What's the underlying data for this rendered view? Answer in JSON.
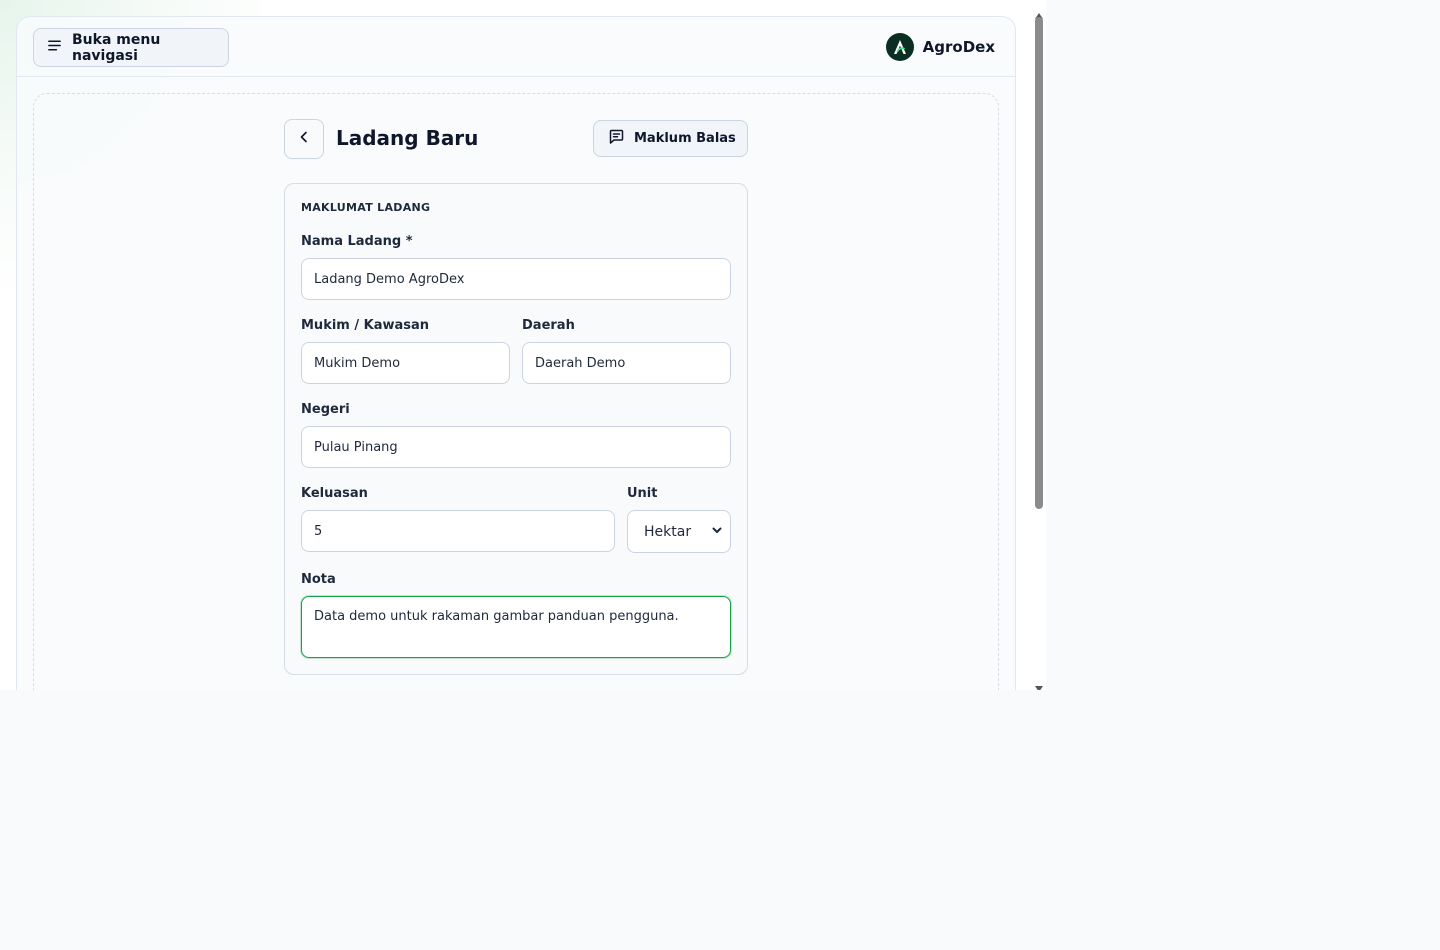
{
  "topbar": {
    "nav_button_label": "Buka menu navigasi",
    "brand_name": "AgroDex"
  },
  "header": {
    "title": "Ladang Baru",
    "feedback_label": "Maklum Balas"
  },
  "form": {
    "section_title": "MAKLUMAT LADANG",
    "farm_name": {
      "label": "Nama Ladang *",
      "value": "Ladang Demo AgroDex"
    },
    "mukim": {
      "label": "Mukim / Kawasan",
      "value": "Mukim Demo"
    },
    "district": {
      "label": "Daerah",
      "value": "Daerah Demo"
    },
    "state": {
      "label": "Negeri",
      "value": "Pulau Pinang"
    },
    "area": {
      "label": "Keluasan",
      "value": "5"
    },
    "unit": {
      "label": "Unit",
      "value": "Hektar"
    },
    "notes": {
      "label": "Nota",
      "value": "Data demo untuk rakaman gambar panduan pengguna."
    }
  },
  "colors": {
    "accent": "#16a34a",
    "brand_logo_bg": "#0b2e22",
    "border": "#cbd5e1",
    "text": "#0f172a"
  },
  "icons": {
    "nav": "menu-icon",
    "back": "chevron-left-icon",
    "feedback": "message-square-icon",
    "brand": "agrodex-logo-icon"
  }
}
